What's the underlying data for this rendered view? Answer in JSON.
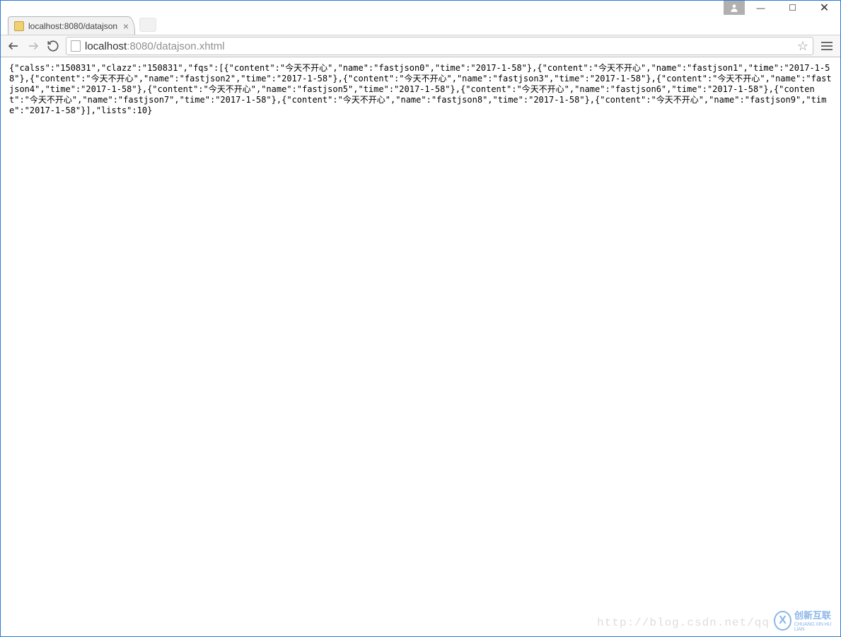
{
  "window": {
    "minimize": "—",
    "maximize": "☐",
    "close": "✕"
  },
  "tab": {
    "title": "localhost:8080/datajson"
  },
  "toolbar": {
    "url_host": "localhost",
    "url_port_path": ":8080/datajson.xhtml"
  },
  "page_body": "{\"calss\":\"150831\",\"clazz\":\"150831\",\"fqs\":[{\"content\":\"今天不开心\",\"name\":\"fastjson0\",\"time\":\"2017-1-58\"},{\"content\":\"今天不开心\",\"name\":\"fastjson1\",\"time\":\"2017-1-58\"},{\"content\":\"今天不开心\",\"name\":\"fastjson2\",\"time\":\"2017-1-58\"},{\"content\":\"今天不开心\",\"name\":\"fastjson3\",\"time\":\"2017-1-58\"},{\"content\":\"今天不开心\",\"name\":\"fastjson4\",\"time\":\"2017-1-58\"},{\"content\":\"今天不开心\",\"name\":\"fastjson5\",\"time\":\"2017-1-58\"},{\"content\":\"今天不开心\",\"name\":\"fastjson6\",\"time\":\"2017-1-58\"},{\"content\":\"今天不开心\",\"name\":\"fastjson7\",\"time\":\"2017-1-58\"},{\"content\":\"今天不开心\",\"name\":\"fastjson8\",\"time\":\"2017-1-58\"},{\"content\":\"今天不开心\",\"name\":\"fastjson9\",\"time\":\"2017-1-58\"}],\"lists\":10}",
  "watermark": {
    "url": "http://blog.csdn.net/qq",
    "brand": "创新互联",
    "brand_sub": "CHUANG XIN HU LIAN"
  }
}
